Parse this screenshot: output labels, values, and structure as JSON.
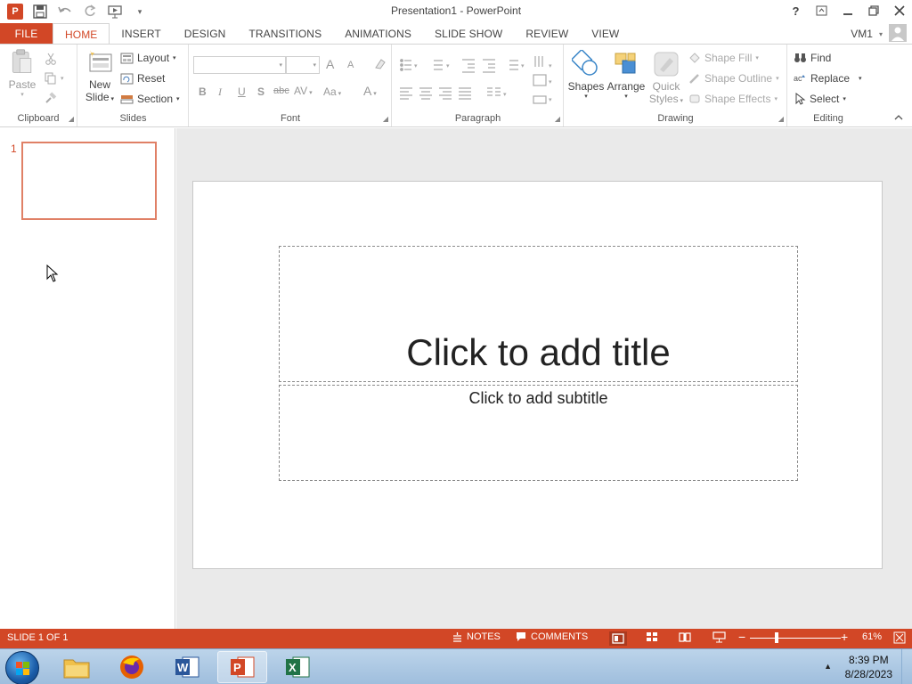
{
  "app": {
    "title": "Presentation1 - PowerPoint",
    "account": "VM1"
  },
  "tabs": [
    "FILE",
    "HOME",
    "INSERT",
    "DESIGN",
    "TRANSITIONS",
    "ANIMATIONS",
    "SLIDE SHOW",
    "REVIEW",
    "VIEW"
  ],
  "ribbon": {
    "clipboard": {
      "label": "Clipboard",
      "paste": "Paste"
    },
    "slides": {
      "label": "Slides",
      "new_slide_1": "New",
      "new_slide_2": "Slide",
      "layout": "Layout",
      "reset": "Reset",
      "section": "Section"
    },
    "font": {
      "label": "Font",
      "bold": "B",
      "italic": "I",
      "underline": "U",
      "shadow": "S",
      "strike": "abc",
      "spacing": "AV",
      "case": "Aa",
      "color": "A",
      "grow": "A",
      "shrink": "A"
    },
    "paragraph": {
      "label": "Paragraph"
    },
    "drawing": {
      "label": "Drawing",
      "shapes": "Shapes",
      "arrange": "Arrange",
      "quick_styles_1": "Quick",
      "quick_styles_2": "Styles",
      "shape_fill": "Shape Fill",
      "shape_outline": "Shape Outline",
      "shape_effects": "Shape Effects"
    },
    "editing": {
      "label": "Editing",
      "find": "Find",
      "replace": "Replace",
      "select": "Select"
    }
  },
  "thumbnails": {
    "slide_number": "1"
  },
  "slide": {
    "title_placeholder": "Click to add title",
    "subtitle_placeholder": "Click to add subtitle"
  },
  "status": {
    "slide_info": "SLIDE 1 OF 1",
    "notes": "NOTES",
    "comments": "COMMENTS",
    "zoom": "61%"
  },
  "taskbar": {
    "time": "8:39 PM",
    "date": "8/28/2023"
  },
  "colors": {
    "accent": "#d24726",
    "thumb_border": "#e08066"
  }
}
